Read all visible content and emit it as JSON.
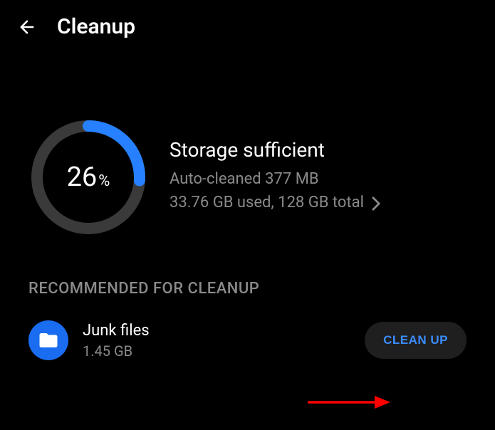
{
  "header": {
    "title": "Cleanup"
  },
  "storage": {
    "percent": "26",
    "percent_sign": "%",
    "status": "Storage sufficient",
    "autoclean": "Auto-cleaned 377 MB",
    "usage": "33.76 GB used, 128 GB total",
    "progress_value": 26
  },
  "section": {
    "recommended_header": "RECOMMENDED FOR CLEANUP"
  },
  "items": {
    "junk": {
      "title": "Junk files",
      "size": "1.45 GB",
      "action": "CLEAN UP"
    }
  },
  "colors": {
    "accent": "#2680ff",
    "accent_text": "#3a8dff",
    "icon_bg": "#1a6cf0",
    "ring_bg": "#3a3a3a",
    "muted": "#8a8a8a"
  }
}
